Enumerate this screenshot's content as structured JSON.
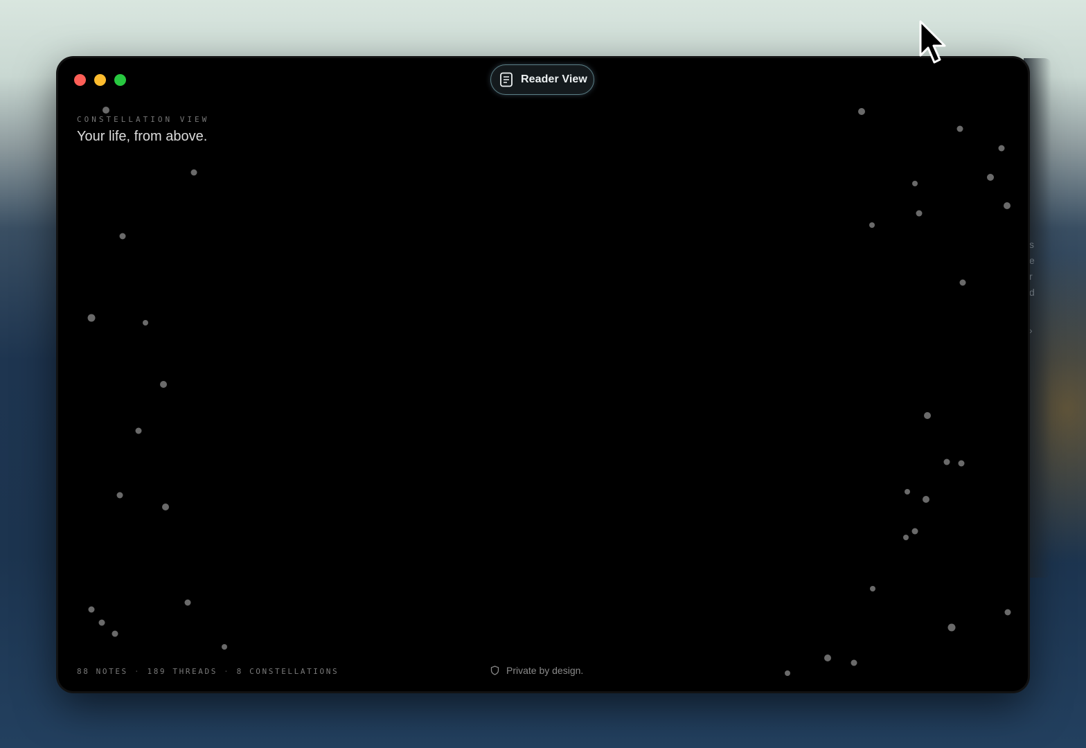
{
  "background_window": {
    "edge_letters": [
      "s",
      "e",
      "r",
      "d"
    ],
    "chevron": "›"
  },
  "window": {
    "reader_button": {
      "label": "Reader View",
      "icon": "document-icon"
    },
    "header": {
      "eyebrow": "CONSTELLATION VIEW",
      "title": "Your life, from above."
    },
    "footer": {
      "notes": "88 NOTES",
      "threads": "189 THREADS",
      "constellations": "8 CONSTELLATIONS",
      "separator": "·",
      "privacy": "Private by design.",
      "privacy_icon": "shield-icon"
    }
  },
  "colors": {
    "window_bg": "#000000",
    "star": "#6a6a6a",
    "reader_border": "#5b7f86"
  }
}
